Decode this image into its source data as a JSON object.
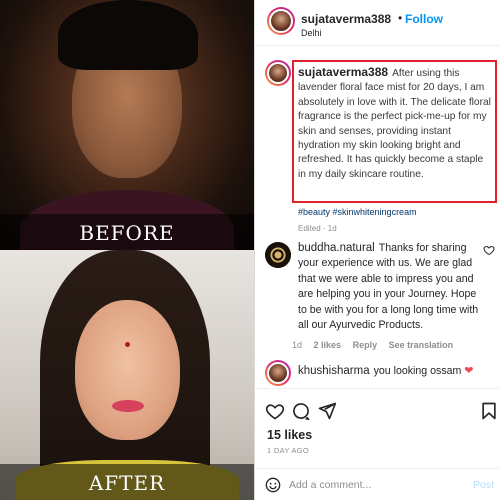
{
  "photos": {
    "before_label": "BEFORE",
    "after_label": "AFTER"
  },
  "post": {
    "author": "sujataverma388",
    "separator": "•",
    "follow_label": "Follow",
    "location": "Delhi",
    "caption_text": "After using this lavender floral face mist for 20 days, I am absolutely in love with it. The delicate floral fragrance is the perfect pick-me-up for my skin and senses, providing instant hydration my skin looking bright and refreshed. It has quickly become a staple in my daily skincare routine.",
    "hashtags": "#beauty #skinwhiteningcream",
    "edited": "Edited · 1d"
  },
  "comments": [
    {
      "username": "buddha.natural",
      "text": "Thanks for sharing your experience with us. We are glad that we were able to impress you and are helping you in your Journey. Hope to be with you for a long long time with all our Ayurvedic Products.",
      "time": "1d",
      "likes": "2 likes",
      "reply_label": "Reply",
      "translation_label": "See translation"
    },
    {
      "username": "khushisharma",
      "text": "you looking ossam",
      "emoji": "❤"
    }
  ],
  "footer": {
    "likes": "15 likes",
    "time_ago": "1 DAY AGO",
    "comment_placeholder": "Add a comment...",
    "post_label": "Post"
  },
  "icons": [
    "heart-icon",
    "comment-icon",
    "share-icon",
    "bookmark-icon",
    "smiley-icon"
  ],
  "colors": {
    "follow": "#0095f6",
    "highlight_border": "#e0202a",
    "hashtag": "#00376b",
    "muted": "#8e8e8e",
    "post_disabled": "#b2dffc"
  }
}
